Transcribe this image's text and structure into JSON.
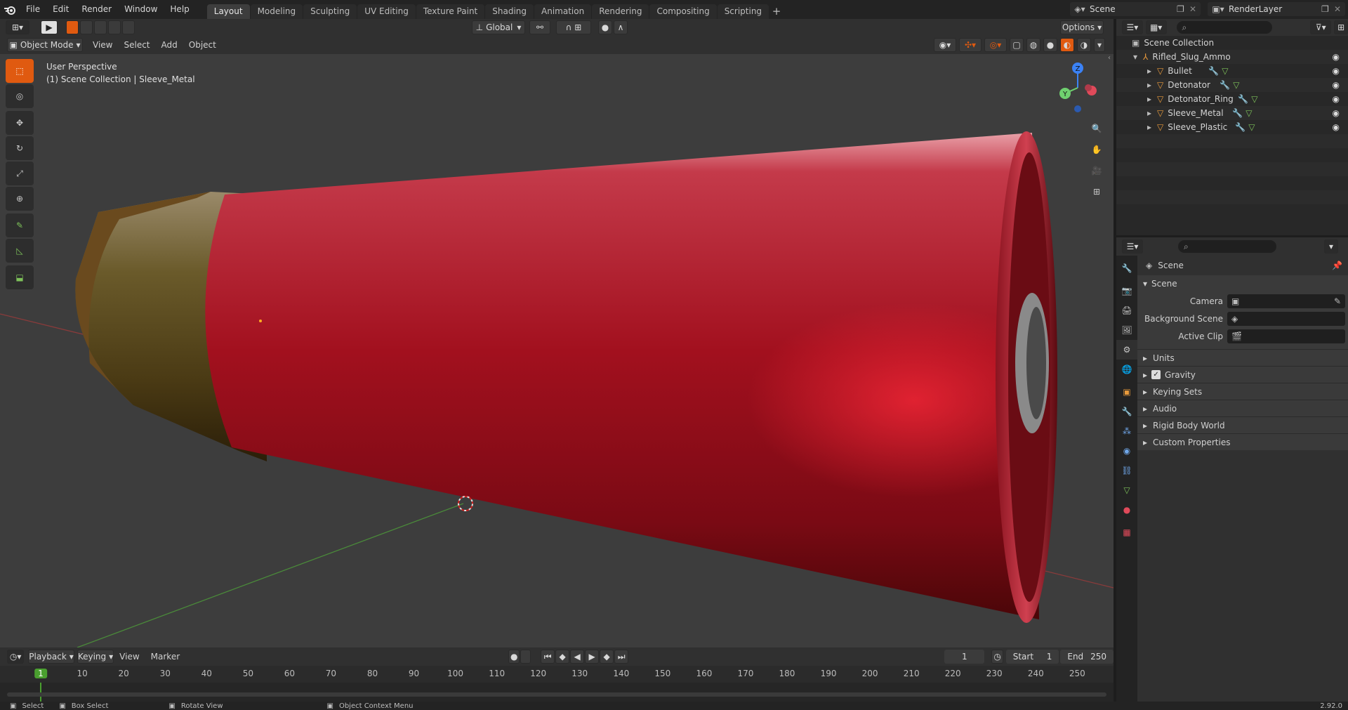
{
  "topbar": {
    "menus": [
      "File",
      "Edit",
      "Render",
      "Window",
      "Help"
    ],
    "tabs": [
      "Layout",
      "Modeling",
      "Sculpting",
      "UV Editing",
      "Texture Paint",
      "Shading",
      "Animation",
      "Rendering",
      "Compositing",
      "Scripting"
    ],
    "active_tab": "Layout",
    "add_tab": "+",
    "scene": "Scene",
    "view_layer": "RenderLayer"
  },
  "viewport_header": {
    "transform_orientation": "Global",
    "options": "Options",
    "mode": "Object Mode",
    "menus": [
      "View",
      "Select",
      "Add",
      "Object"
    ]
  },
  "viewport": {
    "perspective": "User Perspective",
    "collection_info": "(1) Scene Collection | Sleeve_Metal",
    "gizmo_axes": [
      "Z",
      "Y"
    ]
  },
  "outliner": {
    "root": "Scene Collection",
    "collection": "Rifled_Slug_Ammo",
    "objects": [
      "Bullet",
      "Detonator",
      "Detonator_Ring",
      "Sleeve_Metal",
      "Sleeve_Plastic"
    ]
  },
  "properties": {
    "context": "Scene",
    "panel": "Scene",
    "fields": [
      {
        "label": "Camera"
      },
      {
        "label": "Background Scene"
      },
      {
        "label": "Active Clip"
      }
    ],
    "subpanels": [
      "Units",
      "Gravity",
      "Keying Sets",
      "Audio",
      "Rigid Body World",
      "Custom Properties"
    ],
    "gravity_checked": true
  },
  "timeline": {
    "menus": [
      "Playback",
      "Keying",
      "View",
      "Marker"
    ],
    "current_frame": "1",
    "start_label": "Start",
    "start": "1",
    "end_label": "End",
    "end": "250",
    "ruler": [
      "1",
      "10",
      "20",
      "30",
      "40",
      "50",
      "60",
      "70",
      "80",
      "90",
      "100",
      "110",
      "120",
      "130",
      "140",
      "150",
      "160",
      "170",
      "180",
      "190",
      "200",
      "210",
      "220",
      "230",
      "240",
      "250"
    ]
  },
  "statusbar": {
    "items": [
      "Select",
      "Box Select",
      "Rotate View",
      "Object Context Menu"
    ],
    "version": "2.92.0"
  },
  "colors": {
    "accent": "#e05a10",
    "active_frame": "#4a9f2f",
    "object_icon": "#e89a3c",
    "modifier_icon": "#6fa6e8",
    "mesh_icon": "#7ec25a"
  }
}
